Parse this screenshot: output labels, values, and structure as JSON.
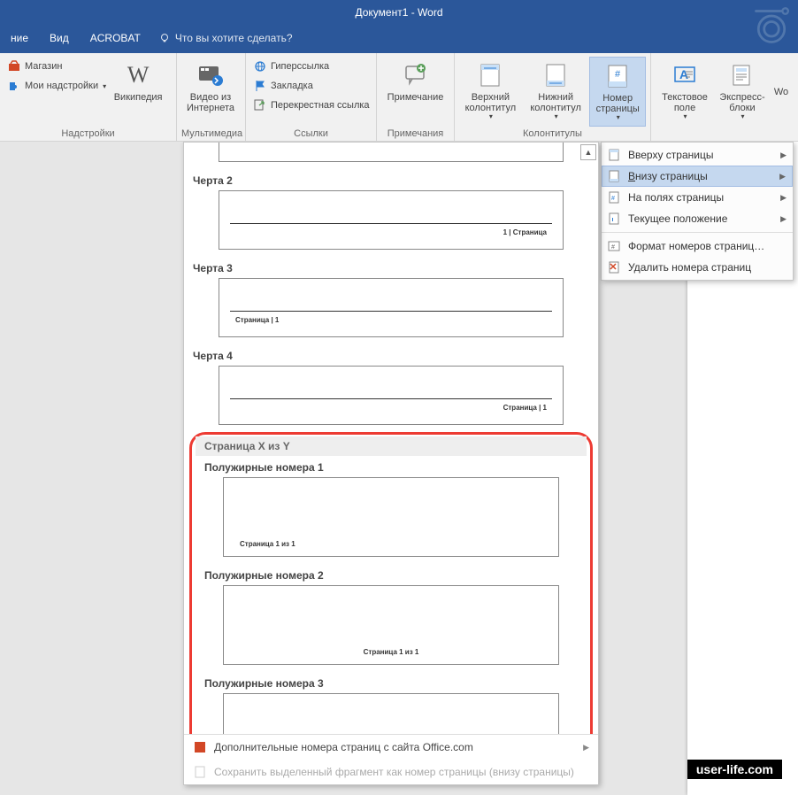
{
  "app": {
    "title": "Документ1 - Word"
  },
  "tabs": {
    "t1": "ние",
    "t2": "Вид",
    "t3": "ACROBAT"
  },
  "tell_me": "Что вы хотите сделать?",
  "ribbon": {
    "addins": {
      "label": "Надстройки",
      "store": "Магазин",
      "mine": "Мои надстройки",
      "wiki": "Википедия"
    },
    "media": {
      "label": "Мультимедиа",
      "video": "Видео из Интернета"
    },
    "links": {
      "label": "Ссылки",
      "hyper": "Гиперссылка",
      "bookmark": "Закладка",
      "cross": "Перекрестная ссылка"
    },
    "comments": {
      "label": "Примечания",
      "note": "Примечание"
    },
    "hf": {
      "label": "Колонтитулы",
      "header": "Верхний колонтитул",
      "footer": "Нижний колонтитул",
      "pagenum": "Номер страницы"
    },
    "text": {
      "label": "",
      "textbox": "Текстовое поле",
      "quick": "Экспресс-блоки",
      "wo": "Wo"
    }
  },
  "submenu": {
    "top": "Вверху страницы",
    "bottom": "Внизу страницы",
    "margins": "На полях страницы",
    "current": "Текущее положение",
    "format": "Формат номеров страниц…",
    "remove": "Удалить номера страниц"
  },
  "gallery": {
    "line2": "Черта 2",
    "line3": "Черта 3",
    "line4": "Черта 4",
    "pv_1pipe": "1 | Страница",
    "pv_sp1": "Страница | 1",
    "pv_sp1b": "Страница | 1",
    "section_xy": "Страница X из Y",
    "bold1": "Полужирные номера 1",
    "bold2": "Полужирные номера 2",
    "bold3": "Полужирные номера 3",
    "pv_xy": "Страница 1 из 1",
    "more": "Дополнительные номера страниц с сайта Office.com",
    "save": "Сохранить выделенный фрагмент как номер страницы (внизу страницы)"
  },
  "credit": "user-life.com"
}
